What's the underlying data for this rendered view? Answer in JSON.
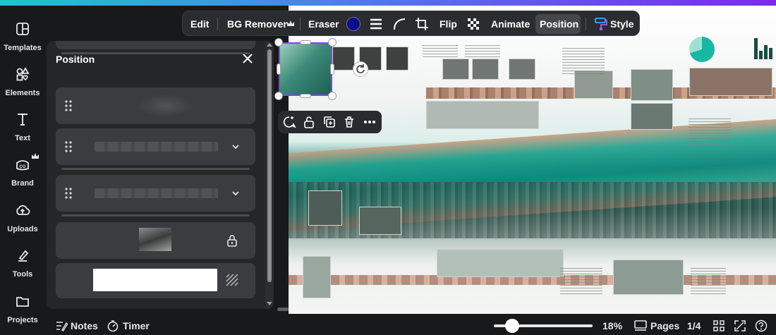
{
  "rail": {
    "items": [
      {
        "label": "Templates",
        "icon": "templates-icon"
      },
      {
        "label": "Elements",
        "icon": "elements-icon"
      },
      {
        "label": "Text",
        "icon": "text-icon"
      },
      {
        "label": "Brand",
        "icon": "brand-icon"
      },
      {
        "label": "Uploads",
        "icon": "uploads-icon"
      },
      {
        "label": "Tools",
        "icon": "tools-icon"
      },
      {
        "label": "Projects",
        "icon": "projects-icon"
      }
    ]
  },
  "toolbar": {
    "edit": "Edit",
    "bg_remover": "BG Remover",
    "eraser": "Eraser",
    "color": "#0c0d8a",
    "flip": "Flip",
    "animate": "Animate",
    "position": "Position",
    "style": "Style"
  },
  "panel": {
    "title": "Position"
  },
  "bottom": {
    "notes": "Notes",
    "timer": "Timer",
    "zoom": "18%",
    "zoom_level": 0.18,
    "pages": "Pages",
    "page_count": "1/4"
  },
  "colors": {
    "accent": "#8b3dff",
    "panel_bg": "#252627",
    "layer_bg": "#3b3c3f",
    "toolbar_bg": "#2b2c2f"
  }
}
